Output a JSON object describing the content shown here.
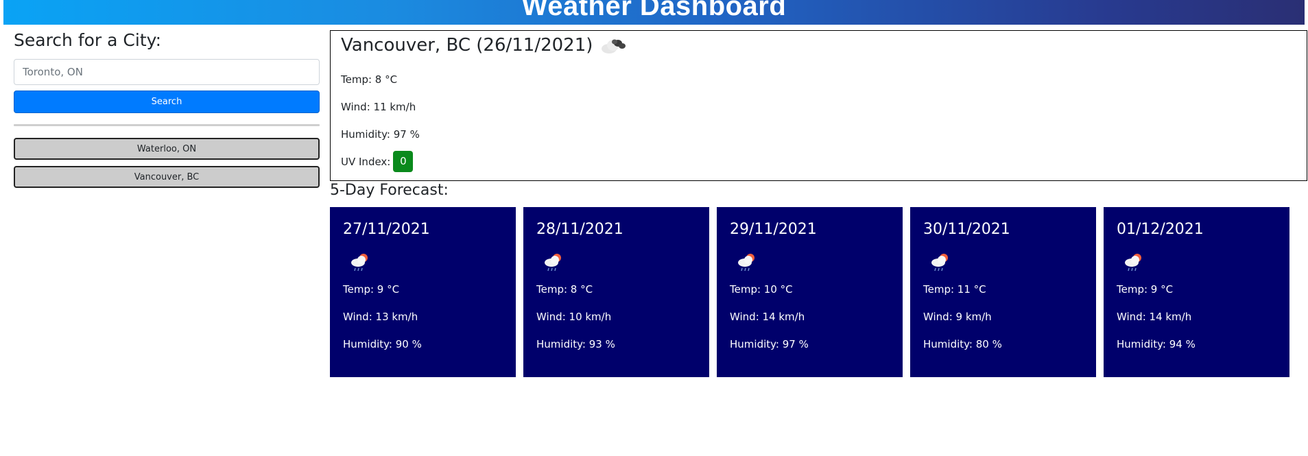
{
  "header": {
    "title": "Weather Dashboard"
  },
  "sidebar": {
    "heading": "Search for a City:",
    "search": {
      "placeholder": "Toronto, ON",
      "value": ""
    },
    "search_button": "Search",
    "history": [
      "Waterloo, ON",
      "Vancouver, BC"
    ]
  },
  "current": {
    "title": "Vancouver, BC (26/11/2021)",
    "icon": "cloudy-icon",
    "temp": "Temp: 8 °C",
    "wind": "Wind: 11 km/h",
    "humidity": "Humidity: 97 %",
    "uv_label": "UV Index:",
    "uv_value": "0",
    "uv_color": "#0a8a1c"
  },
  "forecast": {
    "heading": "5-Day Forecast:",
    "card_color": "#00006b",
    "days": [
      {
        "date": "27/11/2021",
        "icon": "sun-cloud-rain-icon",
        "temp": "Temp: 9 °C",
        "wind": "Wind: 13 km/h",
        "humidity": "Humidity: 90 %"
      },
      {
        "date": "28/11/2021",
        "icon": "sun-cloud-rain-icon",
        "temp": "Temp: 8 °C",
        "wind": "Wind: 10 km/h",
        "humidity": "Humidity: 93 %"
      },
      {
        "date": "29/11/2021",
        "icon": "sun-cloud-rain-icon",
        "temp": "Temp: 10 °C",
        "wind": "Wind: 14 km/h",
        "humidity": "Humidity: 97 %"
      },
      {
        "date": "30/11/2021",
        "icon": "sun-cloud-rain-icon",
        "temp": "Temp: 11 °C",
        "wind": "Wind: 9 km/h",
        "humidity": "Humidity: 80 %"
      },
      {
        "date": "01/12/2021",
        "icon": "sun-cloud-rain-icon",
        "temp": "Temp: 9 °C",
        "wind": "Wind: 14 km/h",
        "humidity": "Humidity: 94 %"
      }
    ]
  }
}
